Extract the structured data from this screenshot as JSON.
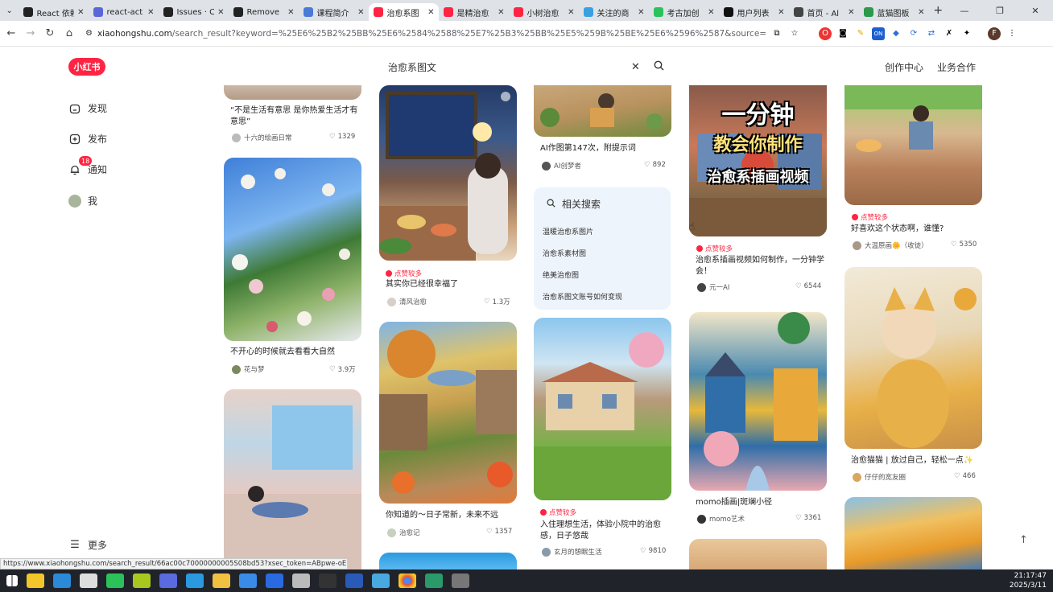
{
  "browser": {
    "tabs": [
      {
        "title": "React 依赖",
        "color": "#222"
      },
      {
        "title": "react-act",
        "color": "#5a67d8"
      },
      {
        "title": "Issues · C",
        "color": "#222"
      },
      {
        "title": "Remove",
        "color": "#222"
      },
      {
        "title": "课程简介",
        "color": "#4a7bd8"
      },
      {
        "title": "治愈系图",
        "color": "#ff2442"
      },
      {
        "title": "是精治愈",
        "color": "#ff2442"
      },
      {
        "title": "小树治愈",
        "color": "#ff2442"
      },
      {
        "title": "关注的商",
        "color": "#3aa0e0"
      },
      {
        "title": "考古加创",
        "color": "#2cc25a"
      },
      {
        "title": "用户列表",
        "color": "#111"
      },
      {
        "title": "首页 - Al",
        "color": "#444"
      },
      {
        "title": "蓝猫图板",
        "color": "#2b9a4a"
      }
    ],
    "active_tab": 5,
    "url_host": "xiaohongshu.com",
    "url_path": "/search_result?keyword=%25E6%25B2%25BB%25E6%2584%2588%25E7%25B3%25BB%25E5%259B%25BE%25E6%2596%2587&source=web_user_page",
    "status_url": "https://www.xiaohongshu.com/search_result/66ac00c70000000005S08bd53?xsec_token=ABpwe-oENwhE2_t..."
  },
  "site": {
    "logo": "小红书",
    "search_value": "治愈系图文",
    "header_links": [
      "创作中心",
      "业务合作"
    ],
    "nav": [
      {
        "label": "发现",
        "icon": "home-icon"
      },
      {
        "label": "发布",
        "icon": "plus-square-icon"
      },
      {
        "label": "通知",
        "icon": "bell-icon"
      },
      {
        "label": "我",
        "icon": "avatar"
      }
    ],
    "notify_count": "18",
    "more_label": "更多"
  },
  "feed": {
    "col1": [
      {
        "title": "“不是生活有意思 是你热爱生活才有意思”",
        "author": "十六的绘画日常",
        "likes": "1329"
      },
      {
        "title": "不开心的时候就去看看大自然",
        "author": "花与梦",
        "likes": "3.9万"
      }
    ],
    "col2": [
      {
        "hot": "点赞较多",
        "title": "其实你已经很幸福了",
        "author": "清风治愈",
        "likes": "1.3万"
      },
      {
        "title": "你知道的～日子常新，未来不远",
        "author": "治愈记",
        "likes": "1357"
      }
    ],
    "col3": [
      {
        "title": "AI作图第147次，附提示词",
        "author": "AI创梦者",
        "likes": "892"
      },
      {
        "hot": "点赞较多",
        "title": "入住理想生活，体验小院中的治愈感，日子悠哉",
        "author": "玄月的憩眠生活",
        "likes": "9810"
      }
    ],
    "col4": [
      {
        "overlay": [
          "一分钟",
          "教会你制作",
          "治愈系插画视频"
        ],
        "hot": "点赞较多",
        "title": "治愈系插画视频如何制作，一分钟学会！",
        "author": "元一AI",
        "likes": "6544"
      },
      {
        "title": "momo插画|斑斓小径",
        "author": "momo艺术",
        "likes": "3361"
      }
    ],
    "col5": [
      {
        "hot": "点赞较多",
        "title": "好喜欢这个状态啊，谁懂?",
        "author": "大温原画🌼（收徒）",
        "likes": "5350"
      },
      {
        "title": "治愈猫猫 | 放过自己，轻松一点✨",
        "author": "仔仔的宽友圈",
        "likes": "466"
      }
    ]
  },
  "related": {
    "header": "相关搜索",
    "items": [
      "温暖治愈系图片",
      "治愈系素材图",
      "绝美治愈图",
      "治愈系图文账号如何变现"
    ]
  },
  "clock": {
    "time": "21:17:47",
    "date": "2025/3/11"
  }
}
